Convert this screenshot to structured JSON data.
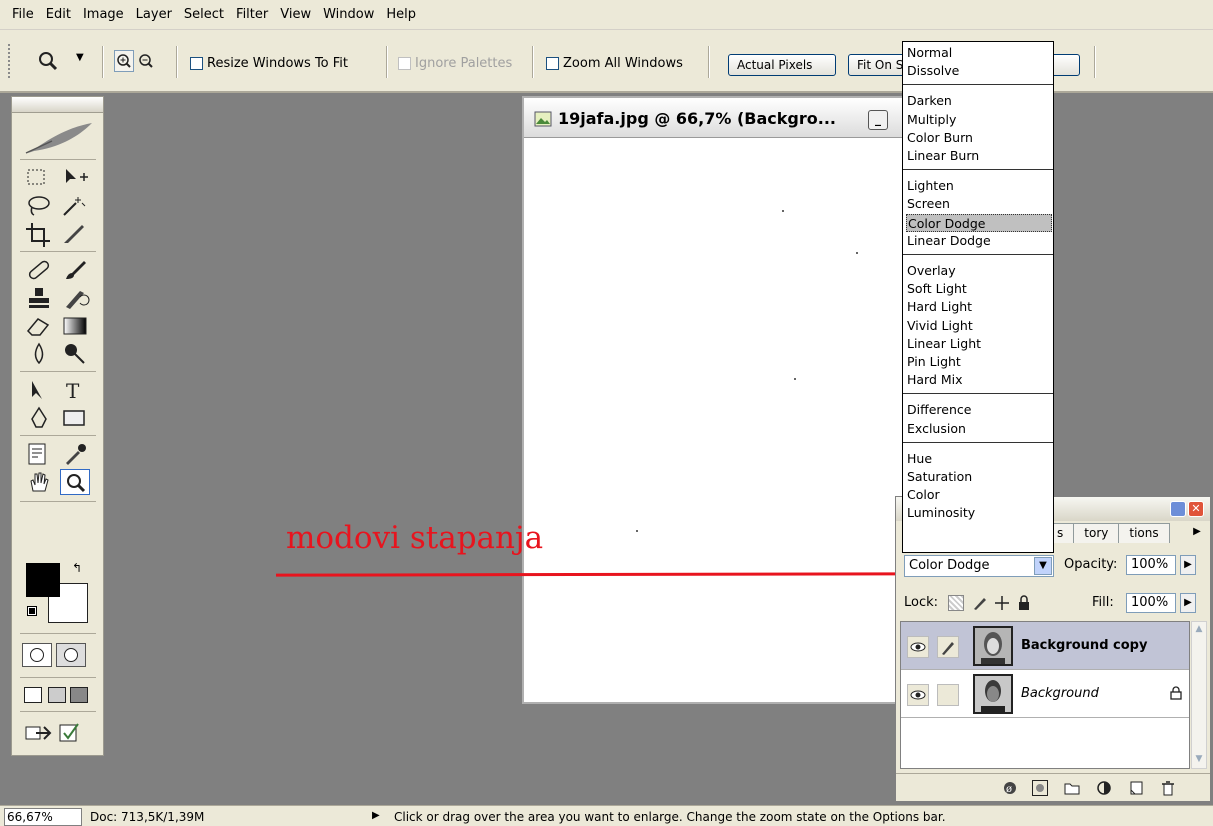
{
  "menu": [
    "File",
    "Edit",
    "Image",
    "Layer",
    "Select",
    "Filter",
    "View",
    "Window",
    "Help"
  ],
  "options": {
    "resize_windows_label": "Resize Windows To Fit",
    "ignore_palettes_label": "Ignore Palettes",
    "zoom_all_label": "Zoom All Windows",
    "actual_pixels_label": "Actual Pixels",
    "fit_on_label": "Fit On S"
  },
  "document": {
    "title": "19jafa.jpg @ 66,7% (Backgro..."
  },
  "blend_modes": {
    "groups": [
      [
        "Normal",
        "Dissolve"
      ],
      [
        "Darken",
        "Multiply",
        "Color Burn",
        "Linear Burn"
      ],
      [
        "Lighten",
        "Screen",
        "Color Dodge",
        "Linear Dodge"
      ],
      [
        "Overlay",
        "Soft Light",
        "Hard Light",
        "Vivid Light",
        "Linear Light",
        "Pin Light",
        "Hard Mix"
      ],
      [
        "Difference",
        "Exclusion"
      ],
      [
        "Hue",
        "Saturation",
        "Color",
        "Luminosity"
      ]
    ],
    "highlighted": "Color Dodge"
  },
  "layers_panel": {
    "tabs": [
      "s",
      "tory",
      "tions"
    ],
    "blend_mode": "Color Dodge",
    "opacity_label": "Opacity:",
    "opacity": "100%",
    "lock_label": "Lock:",
    "fill_label": "Fill:",
    "fill": "100%",
    "layers": [
      {
        "name": "Background copy",
        "selected": true
      },
      {
        "name": "Background",
        "selected": false
      }
    ]
  },
  "annotation": {
    "text": "modovi stapanja",
    "color": "#e8141e"
  },
  "status": {
    "zoom": "66,67%",
    "doc": "Doc: 713,5K/1,39M",
    "hint": "Click or drag over the area you want to enlarge. Change the zoom state on the Options bar."
  }
}
